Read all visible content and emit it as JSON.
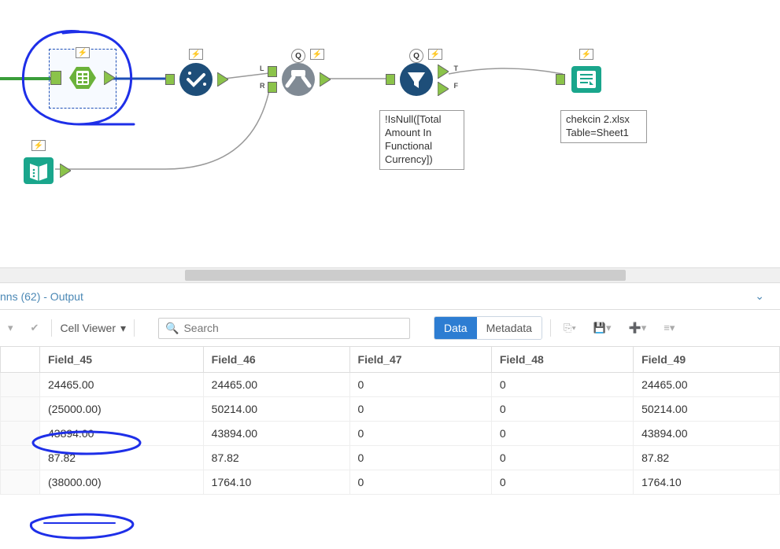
{
  "workflow": {
    "tools": {
      "input1": {
        "icon": "input-data-icon",
        "badge": "lightning"
      },
      "input2": {
        "icon": "book-icon",
        "badge": "lightning"
      },
      "select": {
        "icon": "check-icon",
        "badge": "lightning"
      },
      "join": {
        "icon": "join-icon",
        "badge_q": "Q",
        "badge_l": "lightning",
        "anchors": {
          "L": "L",
          "R": "R"
        }
      },
      "filter": {
        "icon": "filter-funnel-icon",
        "badge_q": "Q",
        "badge_l": "lightning",
        "anchors": {
          "T": "T",
          "F": "F"
        },
        "caption": "!IsNull([Total Amount In Functional Currency])"
      },
      "output": {
        "icon": "output-icon",
        "badge": "lightning",
        "caption": "chekcin 2.xlsx\nTable=Sheet1"
      }
    }
  },
  "results": {
    "title": "nns (62) - Output",
    "cell_viewer_label": "Cell Viewer",
    "search_placeholder": "Search",
    "data_label": "Data",
    "metadata_label": "Metadata",
    "columns": [
      "Field_45",
      "Field_46",
      "Field_47",
      "Field_48",
      "Field_49"
    ],
    "rows": [
      {
        "Field_45": "24465.00",
        "Field_46": "24465.00",
        "Field_47": "0",
        "Field_48": "0",
        "Field_49": "24465.00"
      },
      {
        "Field_45": "(25000.00)",
        "Field_46": "50214.00",
        "Field_47": "0",
        "Field_48": "0",
        "Field_49": "50214.00"
      },
      {
        "Field_45": "43894.00",
        "Field_46": "43894.00",
        "Field_47": "0",
        "Field_48": "0",
        "Field_49": "43894.00"
      },
      {
        "Field_45": "87.82",
        "Field_46": "87.82",
        "Field_47": "0",
        "Field_48": "0",
        "Field_49": "87.82"
      },
      {
        "Field_45": "(38000.00)",
        "Field_46": "1764.10",
        "Field_47": "0",
        "Field_48": "0",
        "Field_49": "1764.10"
      }
    ]
  }
}
